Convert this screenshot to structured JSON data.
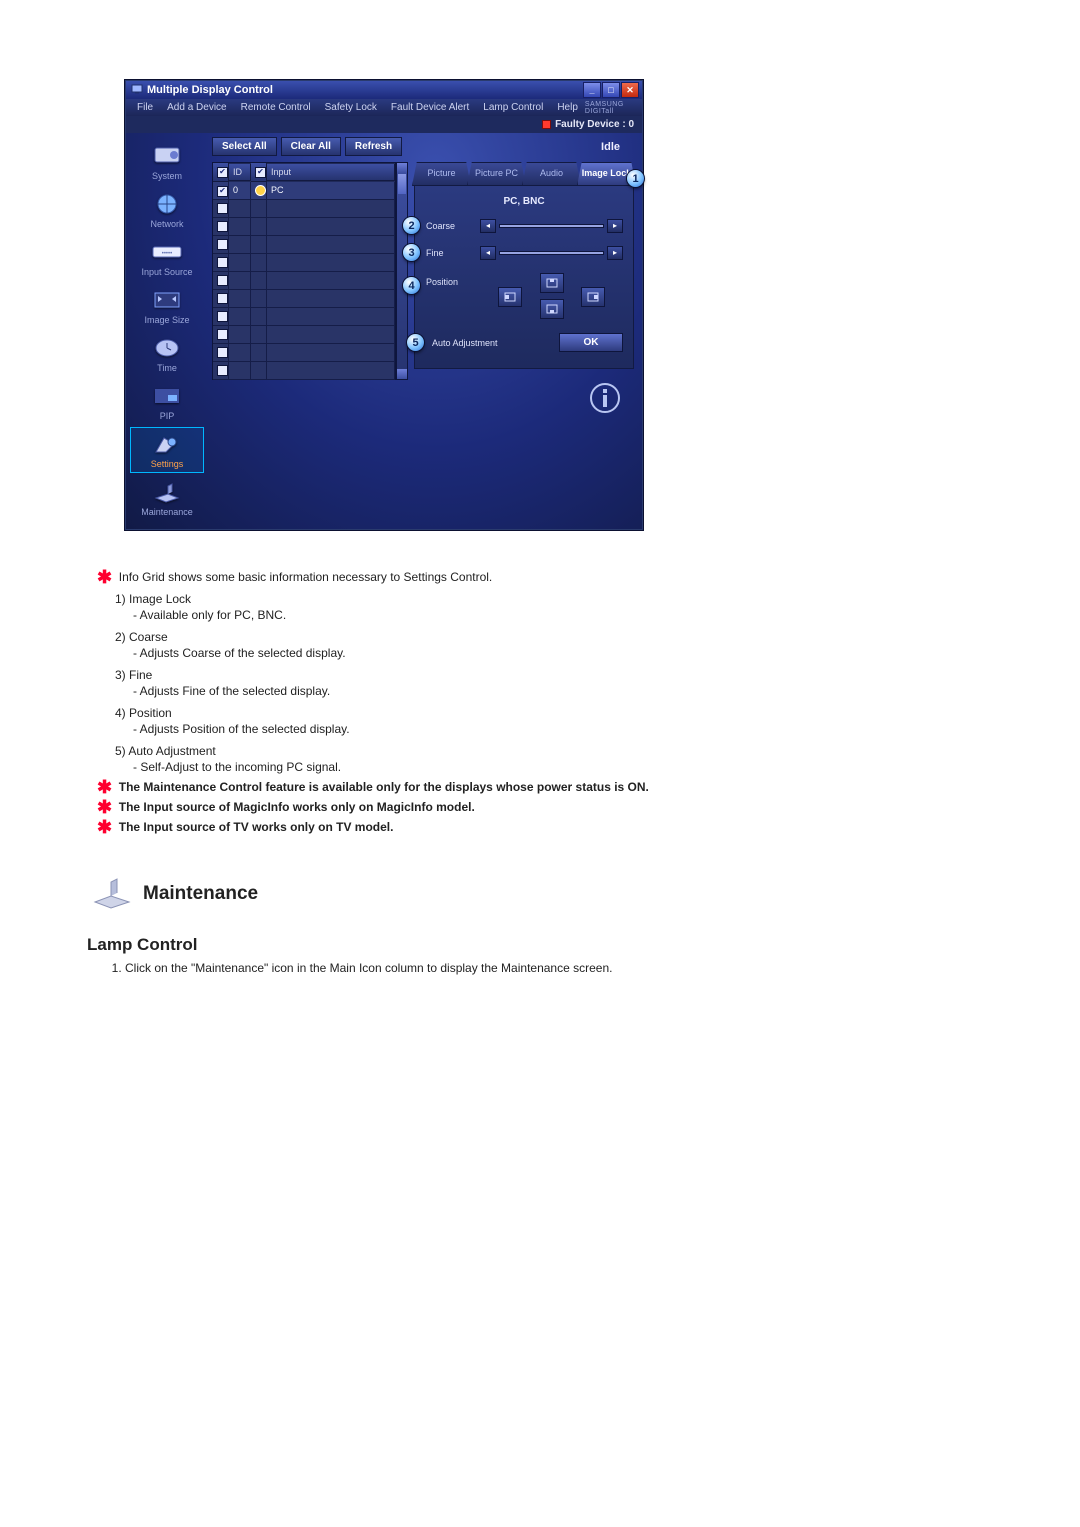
{
  "app": {
    "title": "Multiple Display Control",
    "menu": [
      "File",
      "Add a Device",
      "Remote Control",
      "Safety Lock",
      "Fault Device Alert",
      "Lamp Control",
      "Help"
    ],
    "brand": "SAMSUNG DIGITall",
    "faulty_label": "Faulty Device : 0",
    "toolbar": {
      "select_all": "Select All",
      "clear_all": "Clear All",
      "refresh": "Refresh",
      "idle": "Idle"
    },
    "grid": {
      "headers": {
        "id": "ID",
        "input": "Input"
      },
      "row": {
        "id": "0",
        "input": "PC"
      },
      "blank_rows": 11
    },
    "sidebar": [
      {
        "key": "system",
        "label": "System"
      },
      {
        "key": "network",
        "label": "Network"
      },
      {
        "key": "input-source",
        "label": "Input Source"
      },
      {
        "key": "image-size",
        "label": "Image Size"
      },
      {
        "key": "time",
        "label": "Time"
      },
      {
        "key": "pip",
        "label": "PIP"
      },
      {
        "key": "settings",
        "label": "Settings",
        "selected": true
      },
      {
        "key": "maintenance",
        "label": "Maintenance"
      }
    ],
    "tabs": [
      {
        "key": "picture",
        "label": "Picture"
      },
      {
        "key": "picture-pc",
        "label": "Picture PC"
      },
      {
        "key": "audio",
        "label": "Audio"
      },
      {
        "key": "image-lock",
        "label": "Image Lock",
        "active": true,
        "badge": "1"
      }
    ],
    "panel": {
      "title": "PC, BNC",
      "coarse": {
        "label": "Coarse",
        "badge": "2"
      },
      "fine": {
        "label": "Fine",
        "badge": "3"
      },
      "position": {
        "label": "Position",
        "badge": "4"
      },
      "auto": {
        "label": "Auto Adjustment",
        "badge": "5",
        "ok": "OK"
      }
    }
  },
  "notes": {
    "intro": "Info Grid shows some basic information necessary to Settings Control.",
    "items": [
      {
        "title": "Image Lock",
        "sub": "- Available only for PC, BNC."
      },
      {
        "title": "Coarse",
        "sub": "- Adjusts Coarse of the selected display."
      },
      {
        "title": "Fine",
        "sub": "- Adjusts Fine of the selected display."
      },
      {
        "title": "Position",
        "sub": "- Adjusts Position of the selected display."
      },
      {
        "title": "Auto Adjustment",
        "sub": "- Self-Adjust to the incoming PC signal."
      }
    ],
    "b1": "The Maintenance Control feature is available only for the displays whose power status is ON.",
    "b2": "The Input source of MagicInfo works only on MagicInfo model.",
    "b3": "The Input source of TV works only on TV model."
  },
  "section": {
    "heading": "Maintenance",
    "sub": "Lamp Control",
    "step1": "Click on the \"Maintenance\" icon in the Main Icon column to display the Maintenance screen."
  }
}
